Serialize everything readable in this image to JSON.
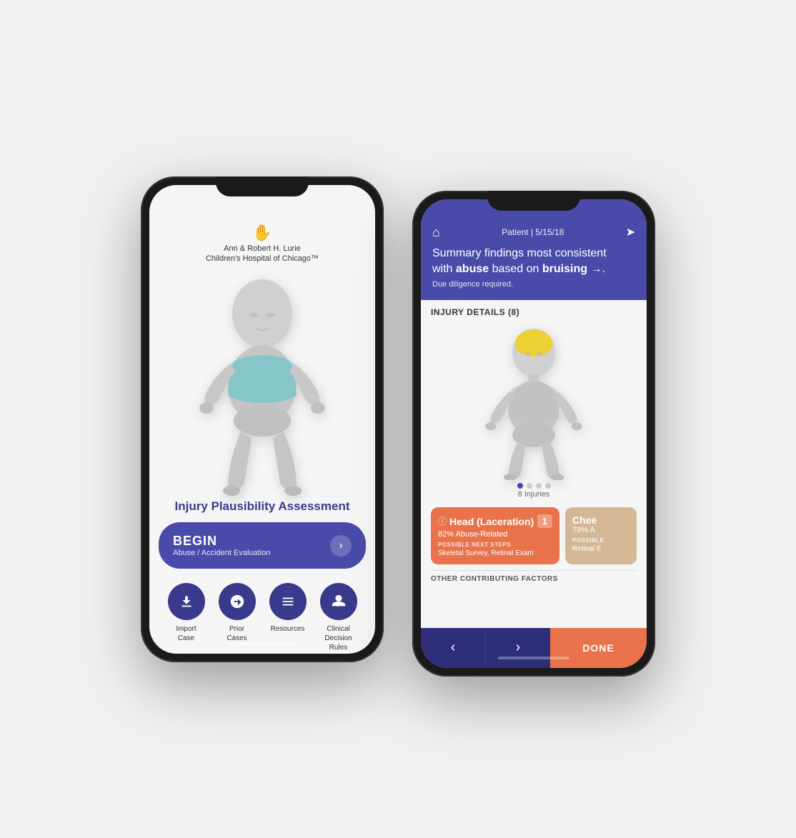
{
  "phone1": {
    "logo": {
      "icon": "✋",
      "line1": "Ann & Robert H. Lurie",
      "line2": "Children's Hospital of Chicago™"
    },
    "assessment_title": "Injury Plausibility Assessment",
    "begin_button": {
      "label": "BEGIN",
      "sub": "Abuse / Accident Evaluation",
      "arrow": "›"
    },
    "bottom_icons": [
      {
        "icon": "⬇",
        "label": "Import\nCase",
        "name": "import-case"
      },
      {
        "icon": "✚",
        "label": "Prior\nCases",
        "name": "prior-cases"
      },
      {
        "icon": "☰",
        "label": "Resources",
        "name": "resources"
      },
      {
        "icon": "🩺",
        "label": "Clinical\nDecision\nRules",
        "name": "clinical-decision-rules"
      }
    ]
  },
  "phone2": {
    "header": {
      "patient_date": "Patient | 5/15/18",
      "summary_line1": "Summary findings most consistent",
      "summary_line2_pre": "with ",
      "summary_bold1": "abuse",
      "summary_line2_mid": " based on ",
      "summary_bold2": "bruising",
      "summary_arrow": " →.",
      "due_diligence": "Due diligence required."
    },
    "injury_section": {
      "title": "INJURY DETAILS (8)",
      "injuries_count": "8 Injuries",
      "dots": [
        true,
        false,
        false,
        false
      ]
    },
    "injury_card_orange": {
      "warn_icon": "ⓘ",
      "title": "Head (Laceration)",
      "badge": "1",
      "pct": "82% Abuse-Related",
      "next_label": "POSSIBLE NEXT STEPS",
      "next_val": "Skeletal Survey, Retinal Exam"
    },
    "injury_card_tan": {
      "title": "Chee",
      "pct": "79% A",
      "next_label": "POSSIBLE",
      "next_val": "Retinal E"
    },
    "other_label": "OTHER CONTRIBUTING FACTORS",
    "nav": {
      "prev": "‹",
      "next": "›",
      "done": "DONE"
    }
  }
}
